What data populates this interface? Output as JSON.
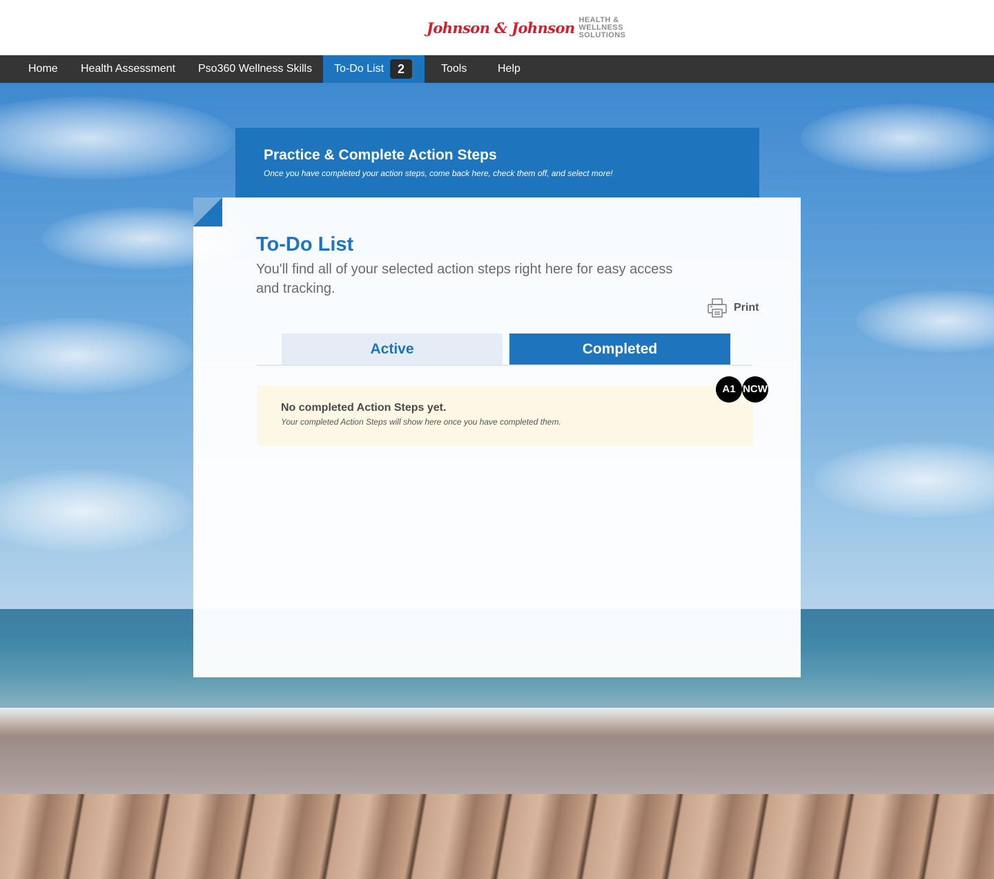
{
  "header": {
    "logo_script": "Johnson & Johnson",
    "logo_lines": [
      "HEALTH &",
      "WELLNESS",
      "SOLUTIONS"
    ]
  },
  "nav": {
    "items": [
      {
        "label": "Home"
      },
      {
        "label": "Health Assessment"
      },
      {
        "label": "Pso360 Wellness Skills"
      },
      {
        "label": "To-Do List",
        "badge": "2",
        "active": true
      },
      {
        "label": "Tools"
      },
      {
        "label": "Help"
      }
    ]
  },
  "banner": {
    "title": "Practice & Complete Action Steps",
    "subtitle": "Once you have completed your action steps, come back here, check them off, and select more!"
  },
  "todo": {
    "title": "To-Do List",
    "description": "You'll find all of your selected action steps right here for easy access and tracking.",
    "print_label": "Print",
    "tabs": [
      {
        "label": "Active",
        "selected": false
      },
      {
        "label": "Completed",
        "selected": true
      }
    ],
    "empty_title": "No completed Action Steps yet.",
    "empty_subtitle": "Your completed Action Steps will show here once you have completed them."
  },
  "overlay_chips": [
    "A1",
    "NCW"
  ],
  "colors": {
    "brand_blue": "#1d75bd",
    "nav_bg": "#353535",
    "notice_bg": "#fdf8e5",
    "logo_red": "#d51e2b"
  },
  "icons": [
    "printer-icon"
  ]
}
